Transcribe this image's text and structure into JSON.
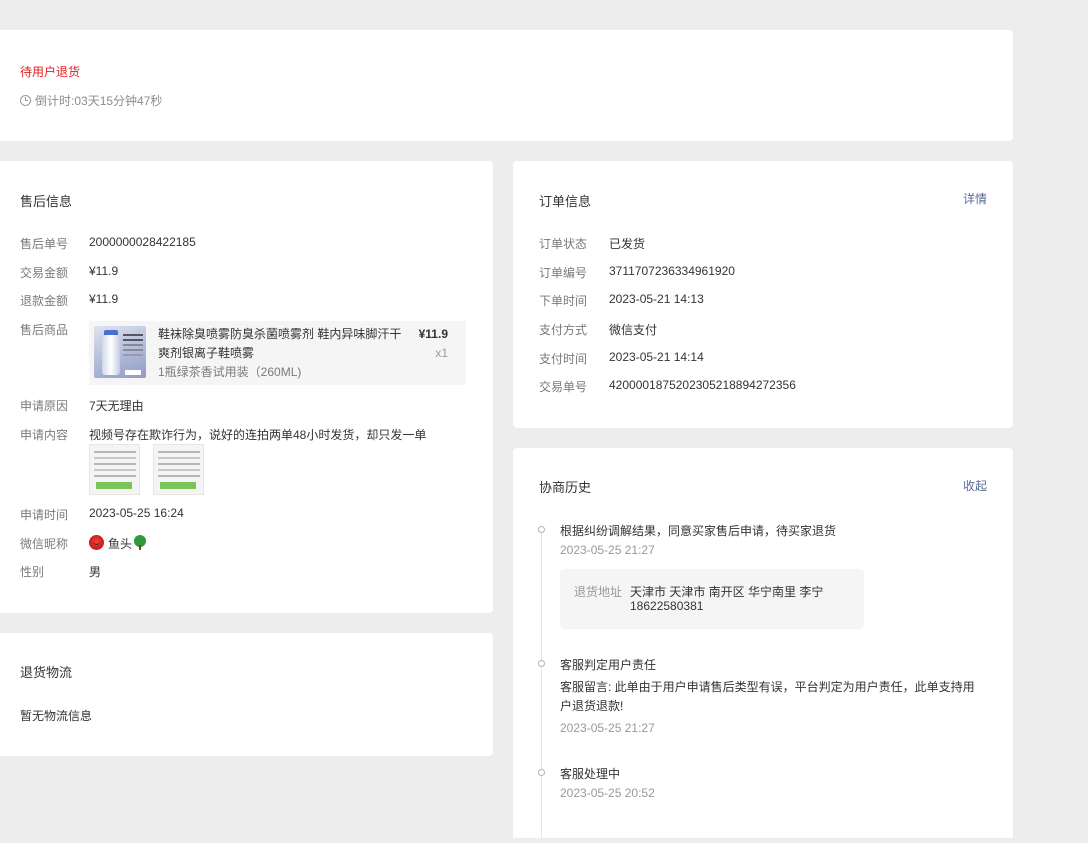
{
  "status": {
    "title": "待用户退货",
    "countdown_label": "倒计时:",
    "countdown_value": "03天15分钟47秒"
  },
  "aftersale": {
    "title": "售后信息",
    "rows": {
      "order_no_label": "售后单号",
      "order_no": "2000000028422185",
      "trade_amount_label": "交易金额",
      "trade_amount": "¥11.9",
      "refund_amount_label": "退款金额",
      "refund_amount": "¥11.9",
      "product_label": "售后商品",
      "reason_label": "申请原因",
      "reason": "7天无理由",
      "content_label": "申请内容",
      "content": "视频号存在欺诈行为，说好的连拍两单48小时发货，却只发一单",
      "apply_time_label": "申请时间",
      "apply_time": "2023-05-25 16:24",
      "nickname_label": "微信昵称",
      "nickname": "鱼头",
      "gender_label": "性别",
      "gender": "男"
    },
    "product": {
      "name": "鞋袜除臭喷雾防臭杀菌喷雾剂 鞋内异味脚汗干爽剂银离子鞋喷雾",
      "spec": "1瓶绿茶香试用装（260ML)",
      "price": "¥11.9",
      "qty": "x1"
    }
  },
  "logistics": {
    "title": "退货物流",
    "empty": "暂无物流信息"
  },
  "order": {
    "title": "订单信息",
    "detail_link": "详情",
    "status_label": "订单状态",
    "status": "已发货",
    "order_no_label": "订单编号",
    "order_no": "3711707236334961920",
    "order_time_label": "下单时间",
    "order_time": "2023-05-21 14:13",
    "pay_method_label": "支付方式",
    "pay_method": "微信支付",
    "pay_time_label": "支付时间",
    "pay_time": "2023-05-21 14:14",
    "trade_no_label": "交易单号",
    "trade_no": "4200001875202305218894272356"
  },
  "history": {
    "title": "协商历史",
    "collapse_link": "收起",
    "items": [
      {
        "title": "根据纠纷调解结果，同意买家售后申请，待买家退货",
        "time": "2023-05-25 21:27",
        "address_label": "退货地址",
        "address_line1": "天津市 天津市 南开区 华宁南里 李宁",
        "address_line2": "18622580381"
      },
      {
        "title": "客服判定用户责任",
        "note": "客服留言: 此单由于用户申请售后类型有误，平台判定为用户责任，此单支持用户退货退款!",
        "time": "2023-05-25 21:27"
      },
      {
        "title": "客服处理中",
        "time": "2023-05-25 20:52"
      }
    ]
  }
}
